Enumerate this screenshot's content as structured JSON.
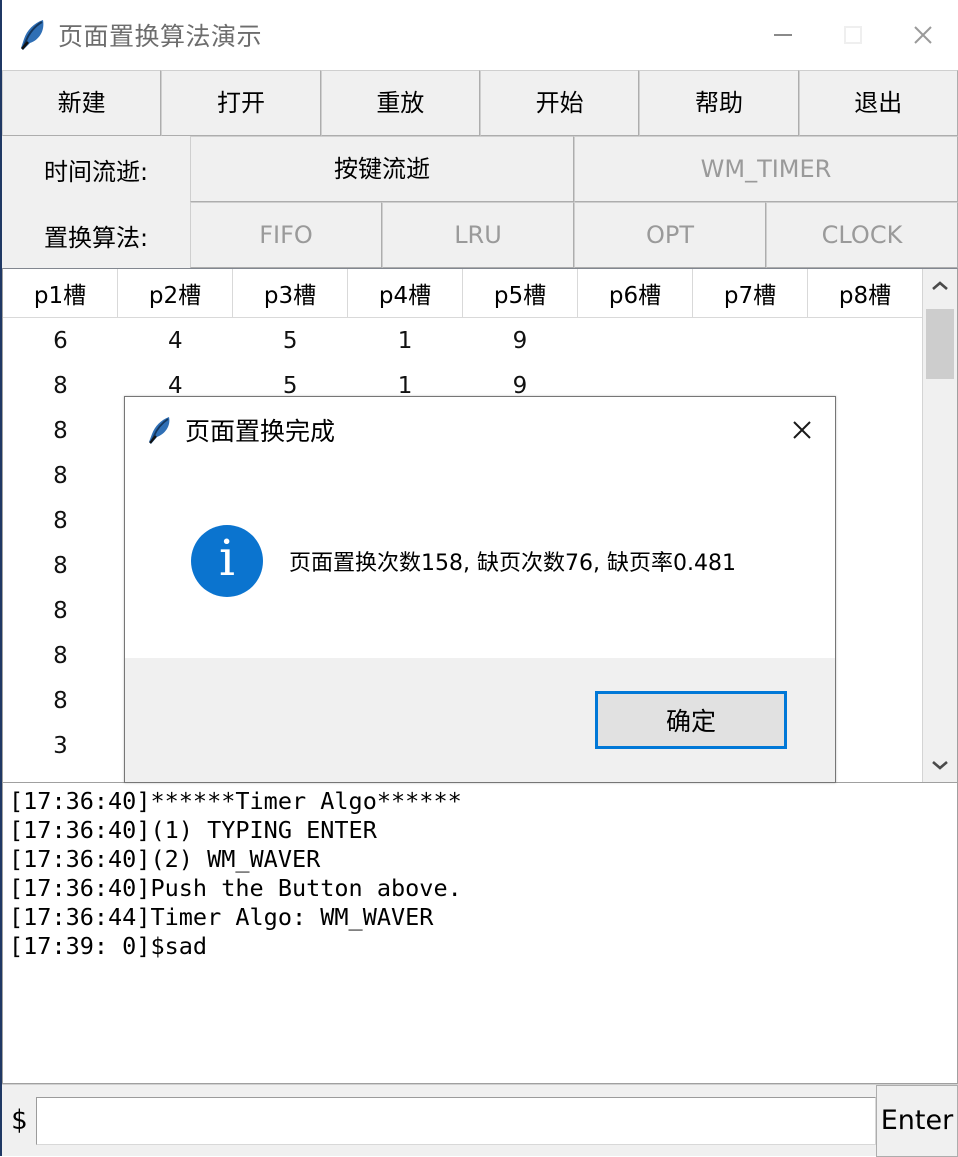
{
  "window": {
    "title": "页面置换算法演示",
    "icon": "feather-quill-icon",
    "controls": {
      "minimize": "minimize-icon",
      "maximize": "maximize-icon",
      "close": "close-icon"
    }
  },
  "toolbar": {
    "main_buttons": [
      {
        "label": "新建",
        "disabled": false
      },
      {
        "label": "打开",
        "disabled": false
      },
      {
        "label": "重放",
        "disabled": false
      },
      {
        "label": "开始",
        "disabled": false
      },
      {
        "label": "帮助",
        "disabled": false
      },
      {
        "label": "退出",
        "disabled": false
      }
    ],
    "time_row": {
      "label": "时间流逝:",
      "buttons": [
        {
          "label": "按键流逝",
          "disabled": false
        },
        {
          "label": "WM_TIMER",
          "disabled": true
        }
      ]
    },
    "algo_row": {
      "label": "置换算法:",
      "buttons": [
        {
          "label": "FIFO",
          "disabled": true
        },
        {
          "label": "LRU",
          "disabled": true
        },
        {
          "label": "OPT",
          "disabled": true
        },
        {
          "label": "CLOCK",
          "disabled": true
        }
      ]
    }
  },
  "table": {
    "columns": [
      "p1槽",
      "p2槽",
      "p3槽",
      "p4槽",
      "p5槽",
      "p6槽",
      "p7槽",
      "p8槽"
    ],
    "rows": [
      [
        "6",
        "4",
        "5",
        "1",
        "9",
        "",
        "",
        ""
      ],
      [
        "8",
        "4",
        "5",
        "1",
        "9",
        "",
        "",
        ""
      ],
      [
        "8",
        "",
        "",
        "",
        "",
        "",
        "",
        ""
      ],
      [
        "8",
        "",
        "",
        "",
        "",
        "",
        "",
        ""
      ],
      [
        "8",
        "",
        "",
        "",
        "",
        "",
        "",
        ""
      ],
      [
        "8",
        "",
        "",
        "",
        "",
        "",
        "",
        ""
      ],
      [
        "8",
        "",
        "",
        "",
        "",
        "",
        "",
        ""
      ],
      [
        "8",
        "",
        "",
        "",
        "",
        "",
        "",
        ""
      ],
      [
        "8",
        "",
        "",
        "",
        "",
        "",
        "",
        ""
      ],
      [
        "3",
        "",
        "",
        "",
        "",
        "",
        "",
        ""
      ]
    ],
    "scrollbar": {
      "up_arrow": "chevron-up-icon",
      "down_arrow": "chevron-down-icon"
    }
  },
  "log": {
    "lines": [
      "[17:36:40]******Timer Algo******",
      "[17:36:40](1) TYPING ENTER",
      "[17:36:40](2) WM_WAVER",
      "[17:36:40]Push the Button above.",
      "[17:36:44]Timer Algo: WM_WAVER",
      "[17:39: 0]$sad"
    ]
  },
  "command": {
    "prompt": "$",
    "value": "",
    "placeholder": "",
    "enter_label": "Enter"
  },
  "dialog": {
    "icon": "feather-quill-icon",
    "title": "页面置换完成",
    "close": "close-icon",
    "info_icon": "info-circle-icon",
    "info_glyph": "i",
    "message": "页面置换次数158, 缺页次数76, 缺页率0.481",
    "ok_label": "确定"
  },
  "colors": {
    "accent": "#0078d7",
    "info_blue": "#0b74cf",
    "toolbar_face": "#f0f0f0",
    "disabled_text": "#9a9a9a",
    "title_text": "#6d6d6d",
    "window_border": "#1f3864"
  }
}
